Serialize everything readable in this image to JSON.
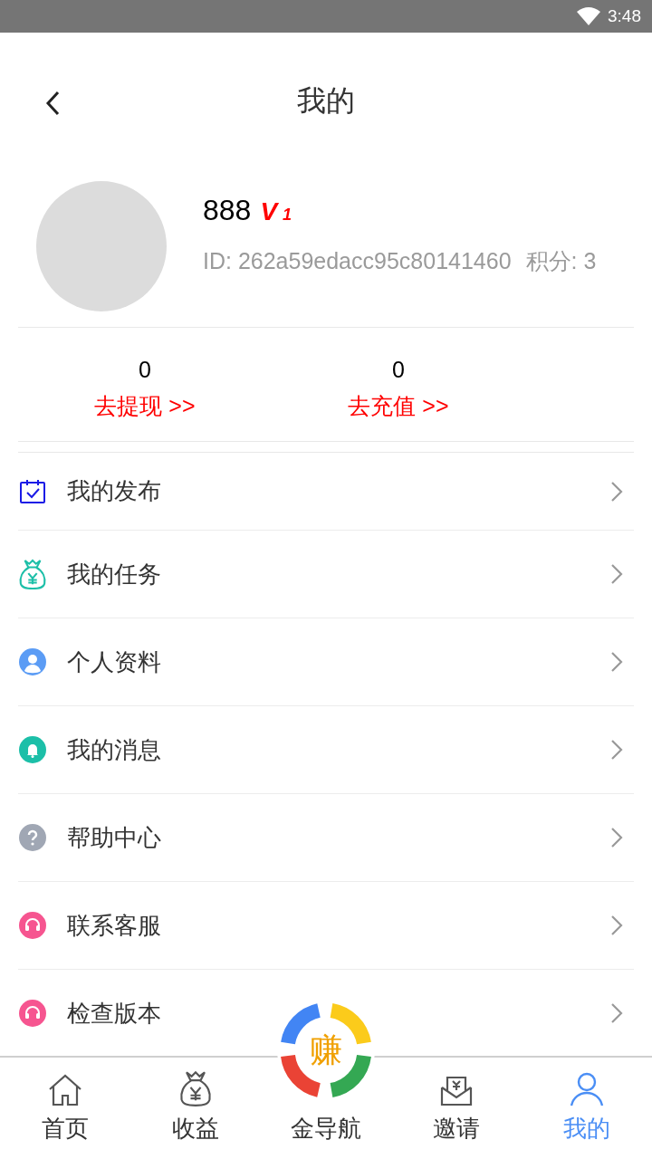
{
  "status_bar": {
    "time": "3:48"
  },
  "header": {
    "title": "我的"
  },
  "profile": {
    "name": "888",
    "vip_letter": "V",
    "vip_level": "1",
    "id": "ID: 262a59edacc95c80141460",
    "points": "积分: 3"
  },
  "stats": [
    {
      "value": "0",
      "action": "去提现 >>"
    },
    {
      "value": "0",
      "action": "去充值 >>"
    }
  ],
  "menu": [
    {
      "kind": "calendar",
      "label": "我的发布",
      "color": "#1a1ae6"
    },
    {
      "kind": "moneybag",
      "label": "我的任务",
      "color": "#1cbfa8"
    },
    {
      "kind": "person",
      "label": "个人资料",
      "color": "#5b9cf5"
    },
    {
      "kind": "bell",
      "label": "我的消息",
      "color": "#1cbfa8"
    },
    {
      "kind": "question",
      "label": "帮助中心",
      "color": "#a0a7b4"
    },
    {
      "kind": "headset",
      "label": "联系客服",
      "color": "#f65590"
    },
    {
      "kind": "headset",
      "label": "检查版本",
      "color": "#f65590"
    }
  ],
  "bottom_nav": [
    {
      "kind": "home",
      "label": "首页",
      "selected": false
    },
    {
      "kind": "moneybag",
      "label": "收益",
      "selected": false
    },
    {
      "kind": "logo",
      "label": "金导航",
      "logo_text": "赚",
      "selected": false
    },
    {
      "kind": "mail",
      "label": "邀请",
      "selected": false
    },
    {
      "kind": "person",
      "label": "我的",
      "selected": true
    }
  ]
}
